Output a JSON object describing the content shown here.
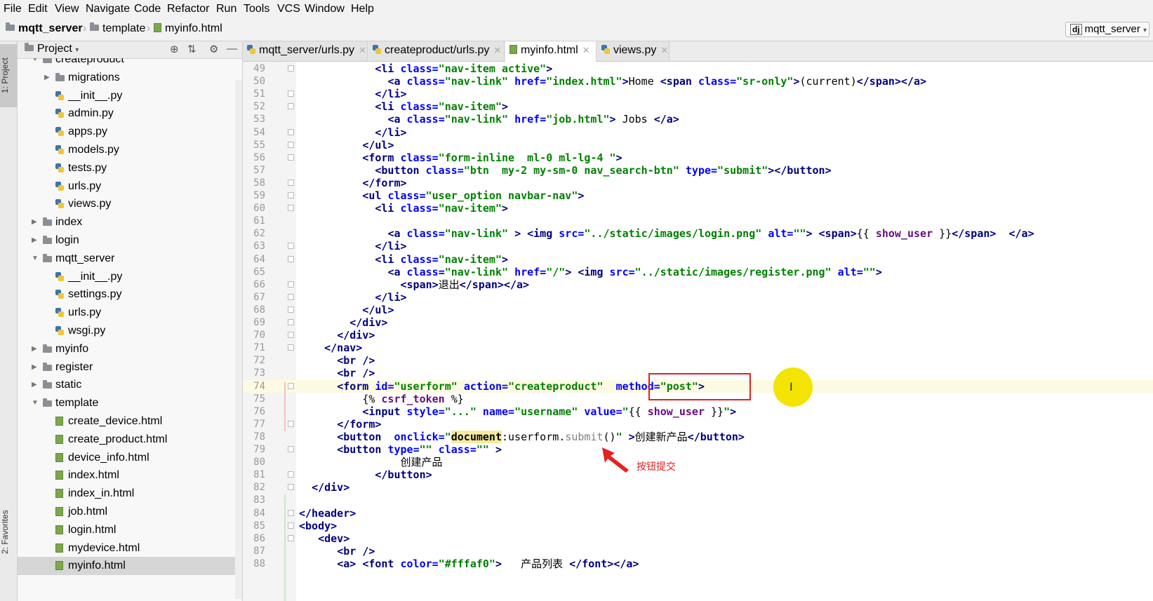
{
  "menu": [
    "File",
    "Edit",
    "View",
    "Navigate",
    "Code",
    "Refactor",
    "Run",
    "Tools",
    "VCS",
    "Window",
    "Help"
  ],
  "breadcrumb": {
    "project": "mqtt_server",
    "folder": "template",
    "file": "myinfo.html"
  },
  "run_config": "mqtt_server",
  "side_tabs": {
    "project": "1: Project",
    "favorites": "2: Favorites"
  },
  "project_panel": {
    "title": "Project"
  },
  "tree": [
    {
      "label": "createproduct",
      "type": "folder",
      "level": 1,
      "expanded": true
    },
    {
      "label": "migrations",
      "type": "folder",
      "level": 2,
      "expanded": false
    },
    {
      "label": "__init__.py",
      "type": "py",
      "level": 2
    },
    {
      "label": "admin.py",
      "type": "py",
      "level": 2
    },
    {
      "label": "apps.py",
      "type": "py",
      "level": 2
    },
    {
      "label": "models.py",
      "type": "py",
      "level": 2
    },
    {
      "label": "tests.py",
      "type": "py",
      "level": 2
    },
    {
      "label": "urls.py",
      "type": "py",
      "level": 2
    },
    {
      "label": "views.py",
      "type": "py",
      "level": 2
    },
    {
      "label": "index",
      "type": "folder",
      "level": 1,
      "expanded": false
    },
    {
      "label": "login",
      "type": "folder",
      "level": 1,
      "expanded": false
    },
    {
      "label": "mqtt_server",
      "type": "folder",
      "level": 1,
      "expanded": true
    },
    {
      "label": "__init__.py",
      "type": "py",
      "level": 2
    },
    {
      "label": "settings.py",
      "type": "py",
      "level": 2
    },
    {
      "label": "urls.py",
      "type": "py",
      "level": 2
    },
    {
      "label": "wsgi.py",
      "type": "py",
      "level": 2
    },
    {
      "label": "myinfo",
      "type": "folder",
      "level": 1,
      "expanded": false
    },
    {
      "label": "register",
      "type": "folder",
      "level": 1,
      "expanded": false
    },
    {
      "label": "static",
      "type": "folder",
      "level": 1,
      "expanded": false
    },
    {
      "label": "template",
      "type": "folder",
      "level": 1,
      "expanded": true
    },
    {
      "label": "create_device.html",
      "type": "html",
      "level": 2
    },
    {
      "label": "create_product.html",
      "type": "html",
      "level": 2
    },
    {
      "label": "device_info.html",
      "type": "html",
      "level": 2
    },
    {
      "label": "index.html",
      "type": "html",
      "level": 2
    },
    {
      "label": "index_in.html",
      "type": "html",
      "level": 2
    },
    {
      "label": "job.html",
      "type": "html",
      "level": 2
    },
    {
      "label": "login.html",
      "type": "html",
      "level": 2
    },
    {
      "label": "mydevice.html",
      "type": "html",
      "level": 2
    },
    {
      "label": "myinfo.html",
      "type": "html",
      "level": 2,
      "selected": true
    }
  ],
  "tabs": [
    {
      "label": "mqtt_server/urls.py",
      "active": false
    },
    {
      "label": "createproduct/urls.py",
      "active": false
    },
    {
      "label": "myinfo.html",
      "active": true
    },
    {
      "label": "views.py",
      "active": false
    }
  ],
  "annotation": {
    "text": "按钮提交",
    "highlight": "method=\"post\">"
  },
  "code": [
    {
      "n": "49",
      "t": "            <li class=\"nav-item active\">"
    },
    {
      "n": "50",
      "t": "              <a class=\"nav-link\" href=\"index.html\">Home <span class=\"sr-only\">(current)</span></a>"
    },
    {
      "n": "51",
      "t": "            </li>"
    },
    {
      "n": "52",
      "t": "            <li class=\"nav-item\">"
    },
    {
      "n": "53",
      "t": "              <a class=\"nav-link\" href=\"job.html\"> Jobs </a>"
    },
    {
      "n": "54",
      "t": "            </li>"
    },
    {
      "n": "55",
      "t": "          </ul>"
    },
    {
      "n": "56",
      "t": "          <form class=\"form-inline  ml-0 ml-lg-4 \">"
    },
    {
      "n": "57",
      "t": "            <button class=\"btn  my-2 my-sm-0 nav_search-btn\" type=\"submit\"></button>"
    },
    {
      "n": "58",
      "t": "          </form>"
    },
    {
      "n": "59",
      "t": "          <ul class=\"user_option navbar-nav\">"
    },
    {
      "n": "60",
      "t": "            <li class=\"nav-item\">"
    },
    {
      "n": "61",
      "t": ""
    },
    {
      "n": "62",
      "t": "              <a class=\"nav-link\" > <img src=\"../static/images/login.png\" alt=\"\"> <span>{{ show_user }}</span>  </a>"
    },
    {
      "n": "63",
      "t": "            </li>"
    },
    {
      "n": "64",
      "t": "            <li class=\"nav-item\">"
    },
    {
      "n": "65",
      "t": "              <a class=\"nav-link\" href=\"/\"> <img src=\"../static/images/register.png\" alt=\"\">"
    },
    {
      "n": "66",
      "t": "                <span>退出</span></a>"
    },
    {
      "n": "67",
      "t": "            </li>"
    },
    {
      "n": "68",
      "t": "          </ul>"
    },
    {
      "n": "69",
      "t": "        </div>"
    },
    {
      "n": "70",
      "t": "      </div>"
    },
    {
      "n": "71",
      "t": "    </nav>"
    },
    {
      "n": "72",
      "t": "      <br />"
    },
    {
      "n": "73",
      "t": "      <br />"
    },
    {
      "n": "74",
      "t": "      <form id=\"userform\" action=\"createproduct\"  method=\"post\">"
    },
    {
      "n": "75",
      "t": "          {% csrf_token %}"
    },
    {
      "n": "76",
      "t": "          <input style=\"...\" name=\"username\" value=\"{{ show_user }}\">"
    },
    {
      "n": "77",
      "t": "      </form>"
    },
    {
      "n": "78",
      "t": "      <button  onclick=\"document:userform.submit()\" >创建新产品</button>"
    },
    {
      "n": "79",
      "t": "      <button type=\"\" class=\"\" >"
    },
    {
      "n": "80",
      "t": "                创建产品"
    },
    {
      "n": "81",
      "t": "            </button>"
    },
    {
      "n": "82",
      "t": "  </div>"
    },
    {
      "n": "83",
      "t": ""
    },
    {
      "n": "84",
      "t": "</header>"
    },
    {
      "n": "85",
      "t": "<body>"
    },
    {
      "n": "86",
      "t": "   <dev>"
    },
    {
      "n": "87",
      "t": "      <br />"
    },
    {
      "n": "88",
      "t": "      <a> <font color=\"#fffaf0\">   产品列表 </font></a>"
    }
  ]
}
